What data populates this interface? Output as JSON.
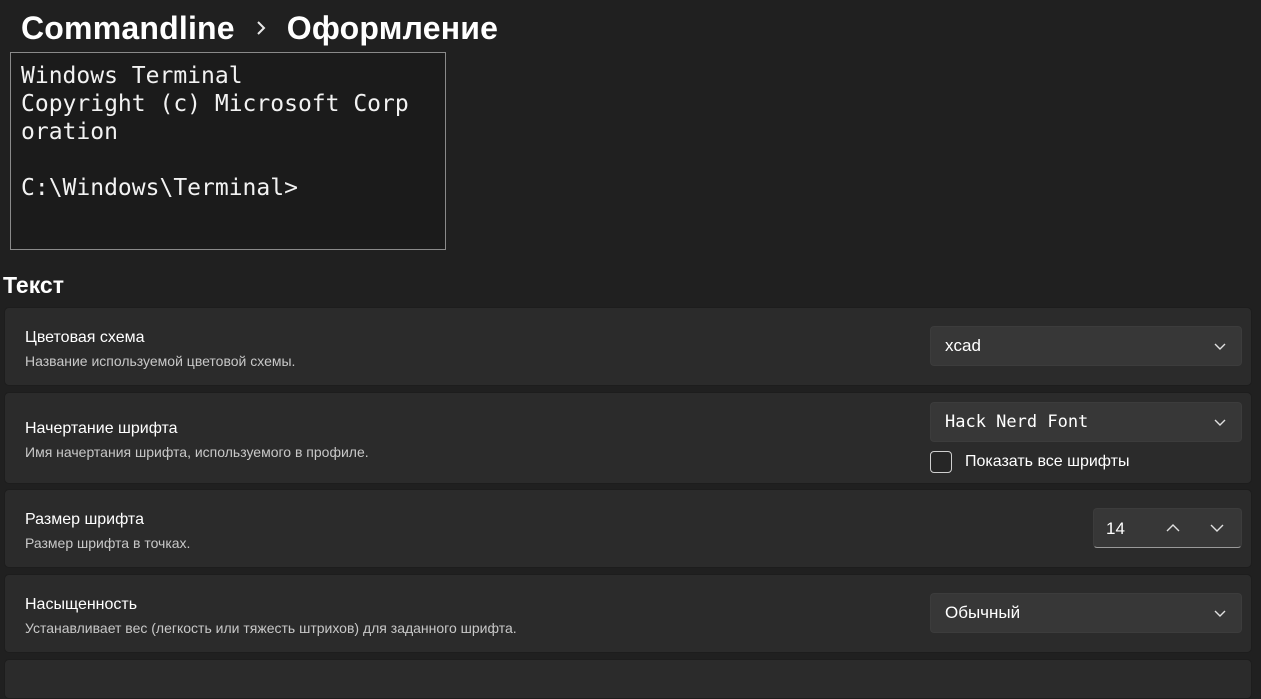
{
  "breadcrumb": {
    "root": "Commandline",
    "current": "Оформление"
  },
  "preview": {
    "text": "Windows Terminal\nCopyright (c) Microsoft Corp\noration\n\nC:\\Windows\\Terminal>"
  },
  "section": {
    "title": "Текст"
  },
  "settings": {
    "color_scheme": {
      "label": "Цветовая схема",
      "description": "Название используемой цветовой схемы.",
      "value": "xcad"
    },
    "font_face": {
      "label": "Начертание шрифта",
      "description": "Имя начертания шрифта, используемого в профиле.",
      "value": "Hack Nerd Font",
      "show_all_fonts_label": "Показать все шрифты",
      "show_all_fonts_checked": false
    },
    "font_size": {
      "label": "Размер шрифта",
      "description": "Размер шрифта в точках.",
      "value": "14"
    },
    "font_weight": {
      "label": "Насыщенность",
      "description": "Устанавливает вес (легкость или тяжесть штрихов) для заданного шрифта.",
      "value": "Обычный"
    }
  },
  "icons": {
    "breadcrumb_separator": "chevron-right-icon",
    "dropdown": "chevron-down-icon",
    "increment": "chevron-up-icon",
    "decrement": "chevron-down-icon"
  }
}
